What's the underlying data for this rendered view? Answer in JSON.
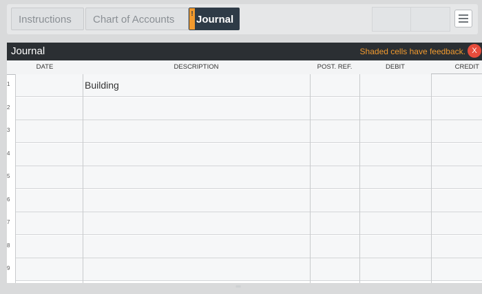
{
  "tabs": {
    "instructions": "Instructions",
    "accounts": "Chart of Accounts",
    "journal": "Journal",
    "journal_flag": "!"
  },
  "panel": {
    "title": "Journal",
    "feedback": "Shaded cells have feedback.",
    "close": "X"
  },
  "columns": {
    "date": "DATE",
    "description": "DESCRIPTION",
    "post_ref": "POST. REF.",
    "debit": "DEBIT",
    "credit": "CREDIT"
  },
  "rows": [
    {
      "num": "1",
      "description": "Building"
    },
    {
      "num": "2",
      "description": ""
    },
    {
      "num": "3",
      "description": ""
    },
    {
      "num": "4",
      "description": ""
    },
    {
      "num": "5",
      "description": ""
    },
    {
      "num": "6",
      "description": ""
    },
    {
      "num": "7",
      "description": ""
    },
    {
      "num": "8",
      "description": ""
    },
    {
      "num": "9",
      "description": ""
    }
  ]
}
